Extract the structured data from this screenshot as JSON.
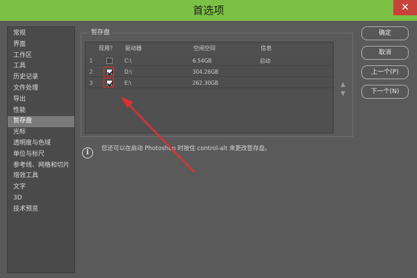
{
  "window": {
    "title": "首选项",
    "close_label": "✕"
  },
  "sidebar": {
    "items": [
      {
        "label": "常规"
      },
      {
        "label": "界面"
      },
      {
        "label": "工作区"
      },
      {
        "label": "工具"
      },
      {
        "label": "历史记录"
      },
      {
        "label": "文件处理"
      },
      {
        "label": "导出"
      },
      {
        "label": "性能"
      },
      {
        "label": "暂存盘",
        "selected": true
      },
      {
        "label": "光标"
      },
      {
        "label": "透明度与色域"
      },
      {
        "label": "单位与标尺"
      },
      {
        "label": "参考线、网格和切片"
      },
      {
        "label": "增效工具"
      },
      {
        "label": "文字"
      },
      {
        "label": "3D"
      },
      {
        "label": "技术预览"
      }
    ]
  },
  "scratch": {
    "group_title": "暂存盘",
    "headers": {
      "active": "现用？",
      "drive": "驱动器",
      "free": "空闲空间",
      "info": "信息"
    },
    "rows": [
      {
        "num": "1",
        "checked": false,
        "drive": "C:\\",
        "free": "6.54GB",
        "info": "启动"
      },
      {
        "num": "2",
        "checked": true,
        "drive": "D:\\",
        "free": "304.26GB",
        "info": ""
      },
      {
        "num": "3",
        "checked": true,
        "drive": "E:\\",
        "free": "262.30GB",
        "info": ""
      }
    ],
    "info_text": "您还可以在启动 Photoshop 时按住 control-alt 来更改暂存盘。"
  },
  "buttons": {
    "ok": "确定",
    "cancel": "取消",
    "prev": "上一个(P)",
    "next": "下一个(N)"
  },
  "icons": {
    "info": "i",
    "move_up": "▲",
    "move_down": "▼"
  },
  "colors": {
    "titlebar": "#7bc144",
    "annotation": "#e03030"
  }
}
